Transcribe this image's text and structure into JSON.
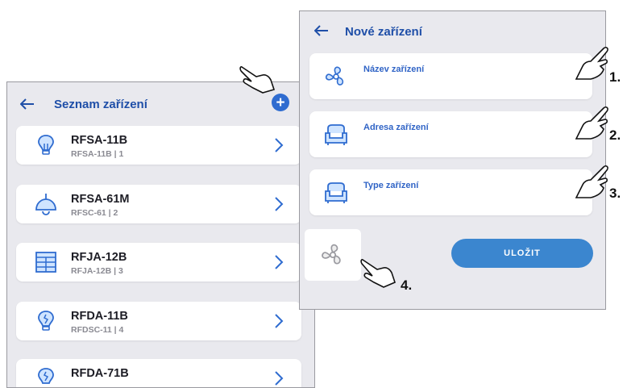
{
  "list_screen": {
    "title": "Seznam zařízení",
    "add_icon": "plus-circle-icon",
    "devices": [
      {
        "name": "RFSA-11B",
        "sub": "RFSA-11B | 1",
        "icon": "bulb-icon"
      },
      {
        "name": "RFSA-61M",
        "sub": "RFSC-61 | 2",
        "icon": "ceiling-lamp-icon"
      },
      {
        "name": "RFJA-12B",
        "sub": "RFJA-12B | 3",
        "icon": "blinds-icon"
      },
      {
        "name": "RFDA-11B",
        "sub": "RFDSC-11 | 4",
        "icon": "dimmer-bulb-icon"
      },
      {
        "name": "RFDA-71B",
        "sub": "",
        "icon": "dimmer-bulb-icon"
      }
    ]
  },
  "new_device_screen": {
    "title": "Nové zařízení",
    "fields": [
      {
        "label": "Název zařízení",
        "icon": "fan-icon"
      },
      {
        "label": "Adresa zařízení",
        "icon": "armchair-icon"
      },
      {
        "label": "Type zařízení",
        "icon": "armchair-icon"
      }
    ],
    "save_label": "ULOŽIT",
    "icon_picker": "fan-icon"
  },
  "annotations": [
    "1.",
    "2.",
    "3.",
    "4."
  ],
  "colors": {
    "accent": "#3064c6",
    "button": "#3b86cf",
    "panel_bg": "#e9e9ee"
  }
}
